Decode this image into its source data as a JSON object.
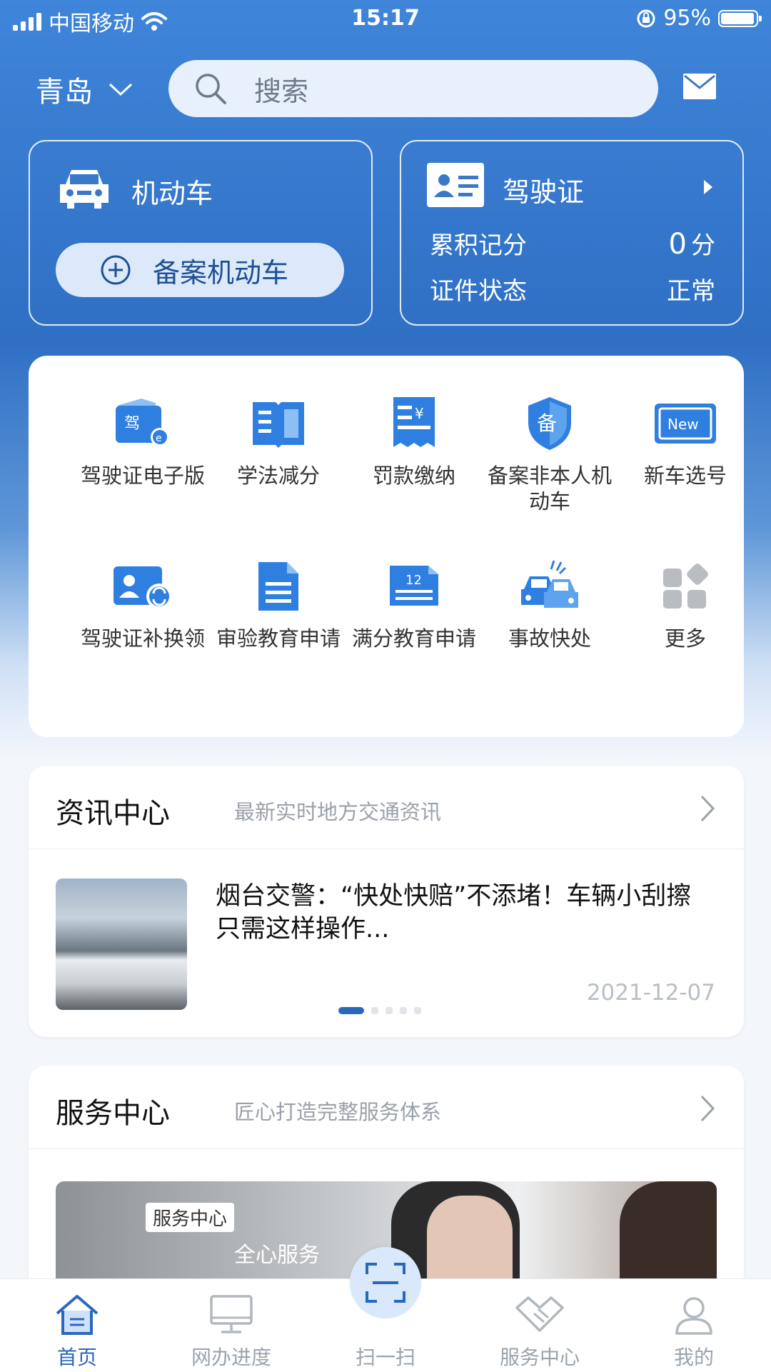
{
  "status_bar": {
    "carrier": "中国移动",
    "time": "15:17",
    "battery": "95%"
  },
  "header": {
    "city": "青岛",
    "search_placeholder": "搜索"
  },
  "vehicle_card": {
    "title": "机动车",
    "register_button": "备案机动车"
  },
  "license_card": {
    "title": "驾驶证",
    "points_label": "累积记分",
    "points_value": "0",
    "points_unit": "分",
    "status_label": "证件状态",
    "status_value": "正常"
  },
  "services": [
    {
      "label": "驾驶证电子版",
      "icon": "e-license-icon"
    },
    {
      "label": "学法减分",
      "icon": "book-icon"
    },
    {
      "label": "罚款缴纳",
      "icon": "receipt-yen-icon"
    },
    {
      "label": "备案非本人机动车",
      "icon": "shield-bei-icon"
    },
    {
      "label": "新车选号",
      "icon": "new-plate-icon"
    },
    {
      "label": "驾驶证补换领",
      "icon": "license-renew-icon"
    },
    {
      "label": "审验教育申请",
      "icon": "document-icon"
    },
    {
      "label": "满分教育申请",
      "icon": "document-12-icon"
    },
    {
      "label": "事故快处",
      "icon": "car-accident-icon"
    },
    {
      "label": "更多",
      "icon": "more-grid-icon"
    }
  ],
  "news": {
    "heading": "资讯中心",
    "subtitle": "最新实时地方交通资讯",
    "article_title": "烟台交警：“快处快赔”不添堵！车辆小刮擦只需这样操作...",
    "article_date": "2021-12-07",
    "carousel_index": 1,
    "carousel_count": 5
  },
  "service_center": {
    "heading": "服务中心",
    "subtitle": "匠心打造完整服务体系",
    "banner_tag": "服务中心",
    "banner_tagline": "全心服务"
  },
  "tabbar": [
    {
      "label": "首页",
      "icon": "home-icon",
      "active": true
    },
    {
      "label": "网办进度",
      "icon": "monitor-icon",
      "active": false
    },
    {
      "label": "扫一扫",
      "icon": "scan-icon",
      "active": false
    },
    {
      "label": "服务中心",
      "icon": "handshake-icon",
      "active": false
    },
    {
      "label": "我的",
      "icon": "user-icon",
      "active": false
    }
  ],
  "colors": {
    "primary": "#2f6fc4",
    "accent": "#2a67bf",
    "icon_blue": "#2f7fe0"
  }
}
